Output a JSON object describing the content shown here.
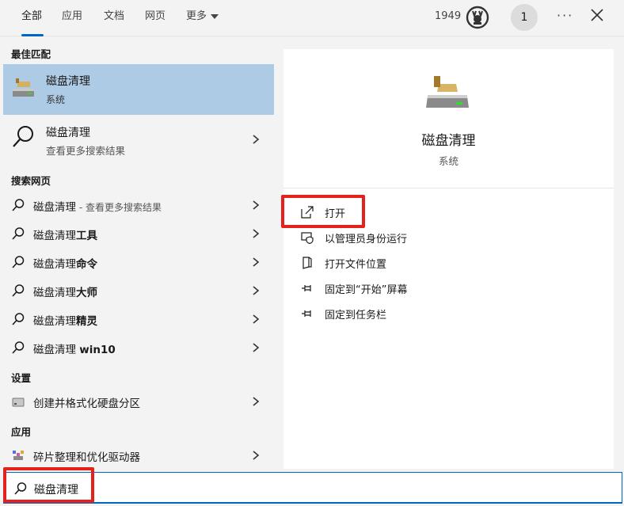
{
  "tabs": [
    {
      "label": "全部",
      "active": true
    },
    {
      "label": "应用"
    },
    {
      "label": "文档"
    },
    {
      "label": "网页"
    },
    {
      "label": "更多"
    }
  ],
  "header": {
    "points": "1949",
    "avatar_initial": "1",
    "more_icon": "more-dots-icon",
    "close_icon": "close-icon"
  },
  "left": {
    "sections": {
      "best_match": "最佳匹配",
      "web": "搜索网页",
      "settings": "设置",
      "apps": "应用"
    },
    "best_match": {
      "title": "磁盘清理",
      "subtitle": "系统"
    },
    "web_search_top": {
      "title": "磁盘清理",
      "subtitle": "查看更多搜索结果"
    },
    "web_items": [
      {
        "prefix": "磁盘清理",
        "bold": "",
        "suffix": " - 查看更多搜索结果"
      },
      {
        "prefix": "磁盘清理",
        "bold": "工具",
        "suffix": ""
      },
      {
        "prefix": "磁盘清理",
        "bold": "命令",
        "suffix": ""
      },
      {
        "prefix": "磁盘清理",
        "bold": "大师",
        "suffix": ""
      },
      {
        "prefix": "磁盘清理",
        "bold": "精灵",
        "suffix": ""
      },
      {
        "prefix": "磁盘清理 ",
        "bold": "win10",
        "suffix": ""
      }
    ],
    "settings_item": {
      "label": "创建并格式化硬盘分区"
    },
    "apps_item": {
      "label": "碎片整理和优化驱动器"
    }
  },
  "preview": {
    "title": "磁盘清理",
    "subtitle": "系统",
    "actions": [
      {
        "label": "打开",
        "icon": "open-icon"
      },
      {
        "label": "以管理员身份运行",
        "icon": "shield-icon"
      },
      {
        "label": "打开文件位置",
        "icon": "file-location-icon"
      },
      {
        "label": "固定到“开始”屏幕",
        "icon": "pin-icon"
      },
      {
        "label": "固定到任务栏",
        "icon": "pin-icon"
      }
    ]
  },
  "search": {
    "value": "磁盘清理"
  },
  "colors": {
    "accent": "#0067c0",
    "highlight": "#aecbe6",
    "annotation_red": "#e3221c"
  }
}
